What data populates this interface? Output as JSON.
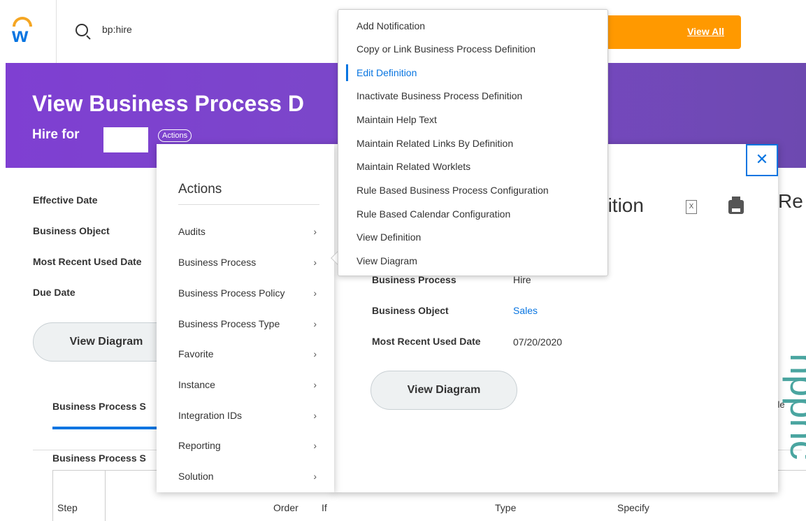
{
  "topbar": {
    "search_value": "bp:hire",
    "view_all_label": "View All"
  },
  "header": {
    "title": "View Business Process D",
    "subtitle": "Hire for",
    "actions_label": "Actions"
  },
  "details": {
    "effective_date_label": "Effective Date",
    "business_object_label": "Business Object",
    "most_recent_used_date_label": "Most Recent Used Date",
    "due_date_label": "Due Date",
    "view_diagram_label": "View Diagram"
  },
  "tabs": {
    "tab1_label": "Business Process S",
    "section_label": "Business Process S",
    "table_headers": [
      "Step",
      "Order",
      "If",
      "Type",
      "Specify"
    ],
    "able_text": "able"
  },
  "modal": {
    "title": "nition",
    "right_text": "Re",
    "close_glyph": "✕",
    "excel_glyph": "X",
    "fields": {
      "business_process_label": "Business Process",
      "business_process_value": "Hire",
      "business_object_label": "Business Object",
      "business_object_value": "Sales",
      "most_recent_label": "Most Recent Used Date",
      "most_recent_value": "07/20/2020"
    },
    "view_diagram_label": "View Diagram"
  },
  "actions_menu": {
    "title": "Actions",
    "items": [
      "Audits",
      "Business Process",
      "Business Process Policy",
      "Business Process Type",
      "Favorite",
      "Instance",
      "Integration IDs",
      "Reporting",
      "Solution"
    ],
    "chevron": "›"
  },
  "submenu": {
    "items": [
      "Add Notification",
      "Copy or Link Business Process Definition",
      "Edit Definition",
      "Inactivate Business Process Definition",
      "Maintain Help Text",
      "Maintain Related Links By Definition",
      "Maintain Related Worklets",
      "Rule Based Business Process Configuration",
      "Rule Based Calendar Configuration",
      "View Definition",
      "View Diagram"
    ],
    "active_index": 2
  },
  "watermark": "nppnc",
  "colors": {
    "accent": "#0875e1",
    "header_purple": "#7f3fd2",
    "orange": "#ff9900"
  }
}
